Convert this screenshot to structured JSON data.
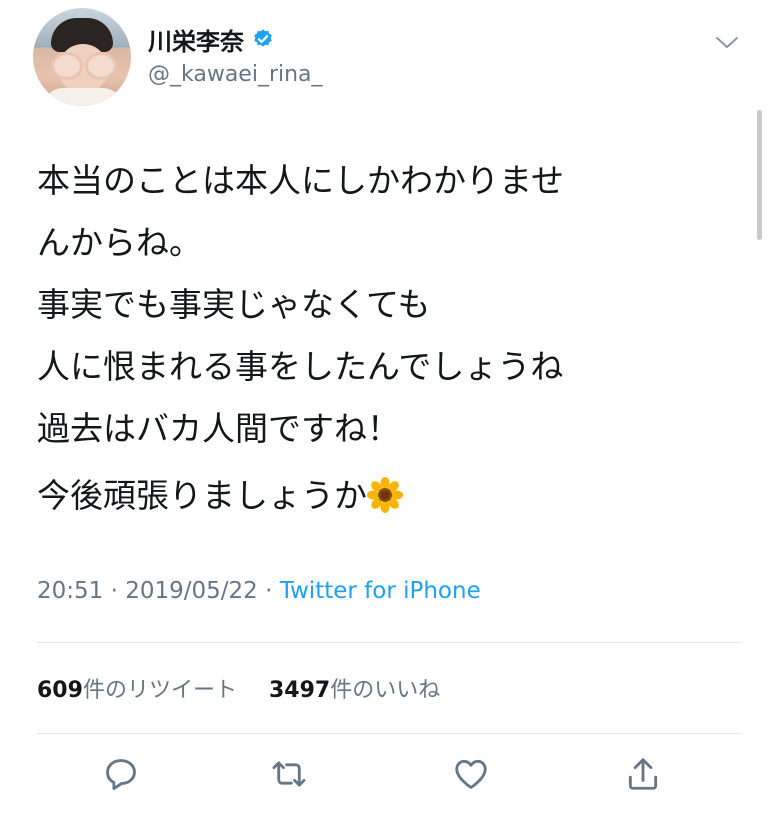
{
  "user": {
    "display_name": "川栄李奈",
    "handle": "@_kawaei_rina_",
    "verified": true
  },
  "tweet": {
    "lines": [
      "本当のことは本人にしかわかりませ",
      "んからね。",
      "事実でも事実じゃなくても",
      "人に恨まれる事をしたんでしょうね",
      "過去はバカ人間ですね！",
      "今後頑張りましょうか"
    ],
    "emoji": "sunflower-icon",
    "time": "20:51",
    "date": "2019/05/22",
    "separator": "·",
    "source": "Twitter for iPhone"
  },
  "stats": {
    "retweets_count": "609",
    "retweets_label": "件のリツイート",
    "likes_count": "3497",
    "likes_label": "件のいいね"
  },
  "actions": [
    "reply-icon",
    "retweet-icon",
    "like-icon",
    "share-icon"
  ],
  "colors": {
    "accent": "#1da1f2",
    "muted": "#657786",
    "text": "#14171a",
    "divider": "#e1e8ed"
  }
}
